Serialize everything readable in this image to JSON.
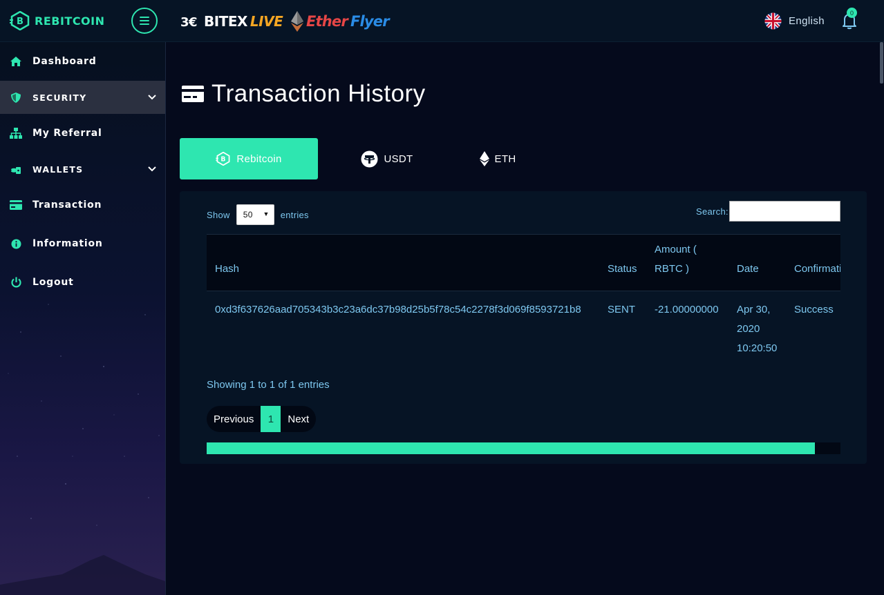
{
  "header": {
    "brand": "REBITCOIN",
    "partner1_a": "BITEX",
    "partner1_b": "LIVE",
    "partner2_a": "Ether",
    "partner2_b": "Flyer",
    "language": "English",
    "notification_count": "0"
  },
  "sidebar": {
    "items": [
      {
        "label": "Dashboard",
        "icon": "home-icon"
      },
      {
        "label": "SECURITY",
        "icon": "shield-icon",
        "active": true,
        "expandable": true
      },
      {
        "label": "My Referral",
        "icon": "sitemap-icon"
      },
      {
        "label": "WALLETS",
        "icon": "wallet-coins-icon",
        "expandable": true
      },
      {
        "label": "Transaction",
        "icon": "credit-card-icon"
      },
      {
        "label": "Information",
        "icon": "info-icon"
      },
      {
        "label": "Logout",
        "icon": "power-icon"
      }
    ]
  },
  "page": {
    "title": "Transaction History",
    "tabs": [
      {
        "label": "Rebitcoin",
        "active": true
      },
      {
        "label": "USDT"
      },
      {
        "label": "ETH"
      }
    ]
  },
  "table": {
    "show_label": "Show",
    "entries_label": "entries",
    "page_size": "50",
    "search_label": "Search:",
    "search_value": "",
    "columns": [
      "Hash",
      "Status",
      "Amount ( RBTC )",
      "Date",
      "Confirmations"
    ],
    "rows": [
      {
        "hash": "0xd3f637626aad705343b3c23a6dc37b98d25b5f78c54c2278f3d069f8593721b8",
        "status": "SENT",
        "amount": "-21.00000000",
        "date": "Apr 30, 2020 10:20:50",
        "confirmation": "Success"
      }
    ],
    "info": "Showing 1 to 1 of 1 entries",
    "pagination": {
      "previous": "Previous",
      "current": "1",
      "next": "Next"
    },
    "horizontal_scroll_fraction": 0.96
  },
  "colors": {
    "accent": "#2ee6b0",
    "background": "#050a1c",
    "panel": "#061425",
    "text_link": "#7ec8f0"
  }
}
